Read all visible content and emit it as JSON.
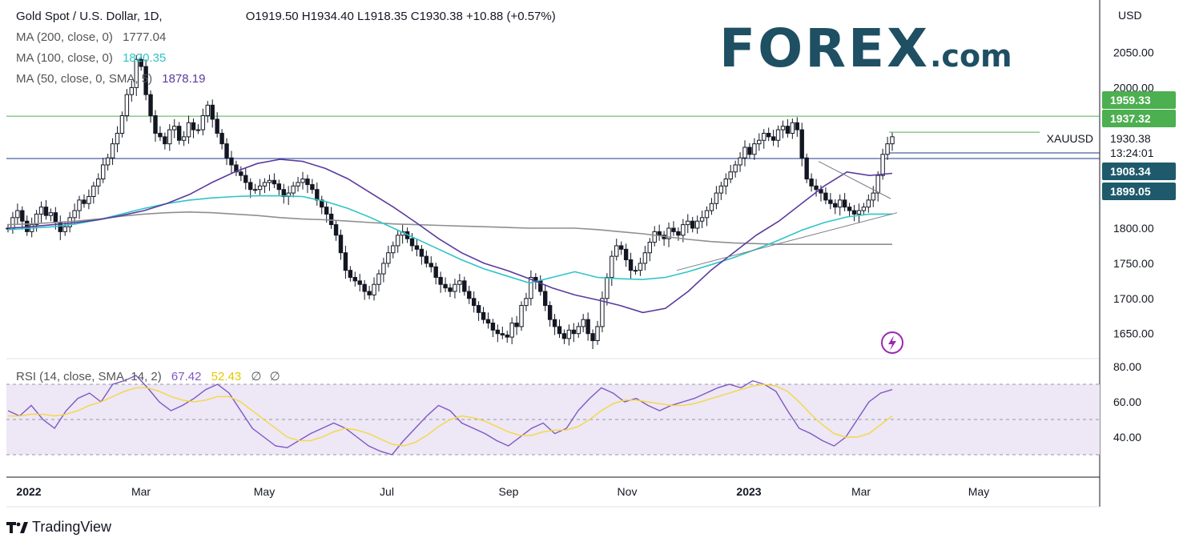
{
  "header": {
    "symbol_title": "Gold Spot / U.S. Dollar, 1D,",
    "ohlc": "O1919.50  H1934.40  L1918.35  C1930.38  +10.88 (+0.57%)",
    "ma200_label": "MA (200, close, 0)",
    "ma200_value": "1777.04",
    "ma100_label": "MA (100, close, 0)",
    "ma100_value": "1820.35",
    "ma50_label": "MA (50, close, 0, SMA, 5)",
    "ma50_value": "1878.19",
    "rsi_label": "RSI (14, close, SMA, 14, 2)",
    "rsi_value": "67.42",
    "rsi_sma_value": "52.43",
    "rsi_extra1": "∅",
    "rsi_extra2": "∅"
  },
  "brand": {
    "main": "FOREX",
    "suffix": ".com"
  },
  "footer": {
    "tradingview": "TradingView"
  },
  "colors": {
    "up": "#131722",
    "down": "#131722",
    "ma200": "#8f8f8f",
    "ma100": "#2ec4c9",
    "ma50": "#5b3a9e",
    "rsi": "#7e57c2",
    "rsi_sma": "#f5d742",
    "rsi_band": "#ede7f6",
    "resistance_line": "#4caf50",
    "support_line": "#1e3a8a",
    "price_badge": "#1e5a6b"
  },
  "chart_data": {
    "type": "candlestick",
    "currency": "USD",
    "y_axis_ticks": [
      "2050.00",
      "2000.00",
      "1800.00",
      "1750.00",
      "1700.00",
      "1650.00"
    ],
    "rsi_axis_ticks": [
      "80.00",
      "60.00",
      "40.00"
    ],
    "x_axis_labels": [
      "2022",
      "Mar",
      "May",
      "Jul",
      "Sep",
      "Nov",
      "2023",
      "Mar",
      "May"
    ],
    "price_labels": [
      {
        "value": "1959.33",
        "kind": "resistance"
      },
      {
        "value": "1937.32",
        "kind": "resistance"
      },
      {
        "value": "1908.34",
        "kind": "support"
      },
      {
        "value": "1899.05",
        "kind": "support"
      }
    ],
    "last_price": {
      "symbol": "XAUUSD",
      "value": "1930.38",
      "countdown": "13:24:01"
    },
    "horizontal_levels": [
      1959.33,
      1899.05
    ],
    "closes": [
      1800,
      1815,
      1825,
      1810,
      1795,
      1805,
      1820,
      1830,
      1818,
      1822,
      1808,
      1795,
      1802,
      1815,
      1825,
      1840,
      1835,
      1845,
      1860,
      1870,
      1890,
      1900,
      1920,
      1935,
      1960,
      1990,
      2000,
      2040,
      2030,
      1990,
      1960,
      1935,
      1930,
      1920,
      1940,
      1945,
      1925,
      1930,
      1950,
      1940,
      1940,
      1960,
      1975,
      1955,
      1935,
      1920,
      1900,
      1890,
      1880,
      1875,
      1865,
      1855,
      1855,
      1860,
      1865,
      1868,
      1863,
      1855,
      1845,
      1850,
      1860,
      1865,
      1870,
      1862,
      1855,
      1840,
      1830,
      1820,
      1805,
      1790,
      1765,
      1740,
      1730,
      1725,
      1720,
      1710,
      1705,
      1720,
      1735,
      1750,
      1765,
      1775,
      1790,
      1795,
      1785,
      1775,
      1770,
      1760,
      1750,
      1745,
      1730,
      1720,
      1715,
      1710,
      1720,
      1725,
      1710,
      1700,
      1690,
      1680,
      1670,
      1665,
      1655,
      1650,
      1648,
      1645,
      1665,
      1660,
      1690,
      1700,
      1730,
      1725,
      1710,
      1690,
      1670,
      1660,
      1650,
      1643,
      1655,
      1650,
      1660,
      1670,
      1650,
      1640,
      1660,
      1700,
      1730,
      1760,
      1775,
      1770,
      1755,
      1740,
      1740,
      1750,
      1765,
      1780,
      1795,
      1790,
      1785,
      1800,
      1795,
      1790,
      1805,
      1810,
      1800,
      1810,
      1815,
      1825,
      1835,
      1850,
      1860,
      1870,
      1880,
      1890,
      1900,
      1915,
      1905,
      1920,
      1925,
      1935,
      1930,
      1925,
      1940,
      1945,
      1935,
      1950,
      1940,
      1900,
      1870,
      1860,
      1855,
      1850,
      1840,
      1835,
      1830,
      1840,
      1830,
      1825,
      1820,
      1825,
      1830,
      1840,
      1850,
      1875,
      1905,
      1920,
      1930
    ],
    "ma50": {
      "from_index": 0,
      "values": [
        1800,
        1802,
        1805,
        1808,
        1812,
        1818,
        1825,
        1835,
        1848,
        1865,
        1880,
        1892,
        1898,
        1895,
        1885,
        1870,
        1850,
        1830,
        1808,
        1785,
        1765,
        1750,
        1740,
        1728,
        1715,
        1705,
        1698,
        1690,
        1680,
        1686,
        1710,
        1740,
        1765,
        1790,
        1810,
        1835,
        1860,
        1880,
        1875,
        1878
      ]
    },
    "ma100": {
      "from_index": 0,
      "values": [
        1798,
        1800,
        1802,
        1806,
        1812,
        1820,
        1828,
        1835,
        1840,
        1843,
        1845,
        1846,
        1846,
        1845,
        1838,
        1828,
        1815,
        1800,
        1785,
        1770,
        1755,
        1742,
        1732,
        1722,
        1730,
        1738,
        1730,
        1728,
        1727,
        1730,
        1738,
        1748,
        1758,
        1770,
        1783,
        1797,
        1808,
        1816,
        1820,
        1820
      ]
    },
    "ma200": {
      "from_index": 0,
      "values": [
        1805,
        1806,
        1808,
        1810,
        1813,
        1817,
        1820,
        1822,
        1823,
        1822,
        1820,
        1818,
        1815,
        1813,
        1812,
        1810,
        1808,
        1806,
        1805,
        1804,
        1803,
        1802,
        1801,
        1800,
        1800,
        1800,
        1798,
        1795,
        1792,
        1788,
        1784,
        1781,
        1779,
        1778,
        1777,
        1777,
        1777,
        1777,
        1777,
        1777
      ]
    },
    "rsi": [
      55,
      52,
      58,
      50,
      45,
      55,
      62,
      65,
      60,
      70,
      72,
      75,
      68,
      60,
      55,
      58,
      62,
      67,
      70,
      65,
      55,
      45,
      40,
      35,
      34,
      38,
      42,
      45,
      48,
      45,
      40,
      35,
      32,
      30,
      38,
      45,
      52,
      58,
      55,
      48,
      45,
      42,
      38,
      35,
      40,
      45,
      48,
      42,
      45,
      55,
      62,
      68,
      65,
      60,
      62,
      58,
      55,
      58,
      60,
      62,
      65,
      68,
      70,
      68,
      72,
      70,
      66,
      55,
      45,
      42,
      38,
      35,
      40,
      50,
      60,
      65,
      67
    ],
    "rsi_sma": [
      52,
      52,
      53,
      53,
      52,
      53,
      55,
      58,
      60,
      63,
      66,
      68,
      68,
      66,
      63,
      61,
      60,
      61,
      63,
      63,
      60,
      55,
      50,
      45,
      40,
      38,
      38,
      40,
      43,
      45,
      44,
      42,
      39,
      36,
      35,
      37,
      41,
      46,
      50,
      52,
      51,
      49,
      46,
      43,
      41,
      41,
      43,
      44,
      44,
      46,
      50,
      55,
      59,
      61,
      61,
      60,
      59,
      58,
      58,
      59,
      61,
      63,
      65,
      67,
      69,
      70,
      69,
      66,
      60,
      53,
      47,
      42,
      40,
      40,
      42,
      47,
      52
    ],
    "rsi_levels": [
      70,
      50,
      30
    ]
  }
}
